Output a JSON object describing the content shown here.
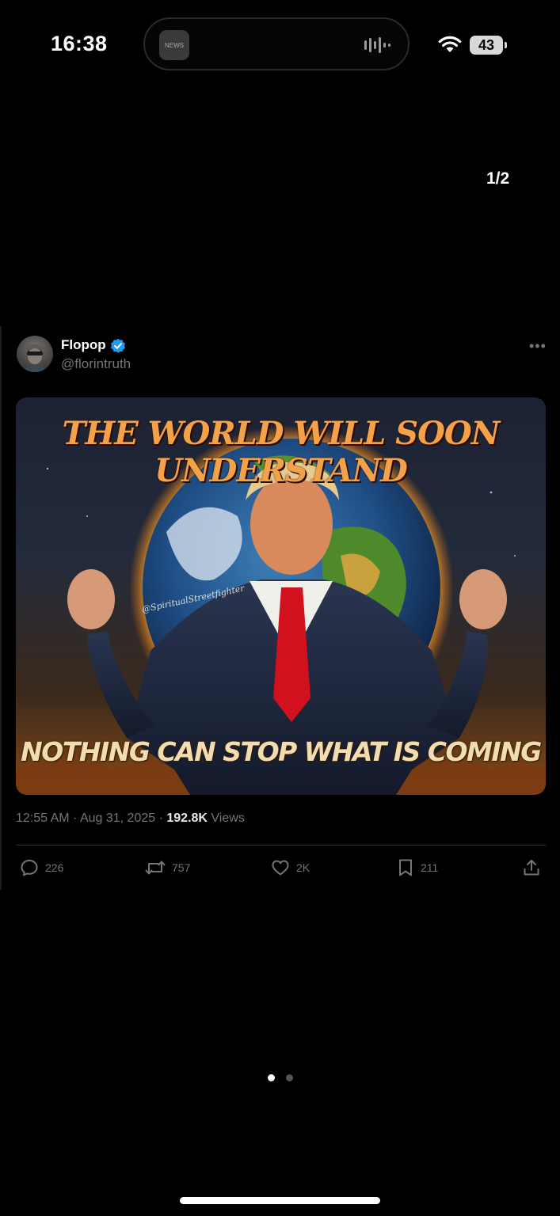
{
  "status_bar": {
    "time": "16:38",
    "island_app_label": "NEWS",
    "battery": "43"
  },
  "viewer": {
    "page_counter": "1/2",
    "pager": {
      "total": 2,
      "current": 1
    }
  },
  "tweet": {
    "author": {
      "name": "Flopop",
      "handle": "@florintruth",
      "verified": true
    },
    "media": {
      "headline": "THE WORLD WILL SOON UNDERSTAND",
      "watermark": "@SpiritualStreetfighter",
      "caption": "NOTHING CAN STOP WHAT IS COMING"
    },
    "meta": {
      "time": "12:55 AM",
      "date": "Aug 31, 2025",
      "views": "192.8K",
      "views_label": "Views",
      "separator": " · "
    },
    "actions": {
      "replies": "226",
      "reposts": "757",
      "likes": "2K",
      "bookmarks": "211"
    }
  },
  "colors": {
    "background": "#000000",
    "muted_text": "#71767b",
    "verified_badge": "#1d9bf0",
    "divider": "#2f3336"
  }
}
